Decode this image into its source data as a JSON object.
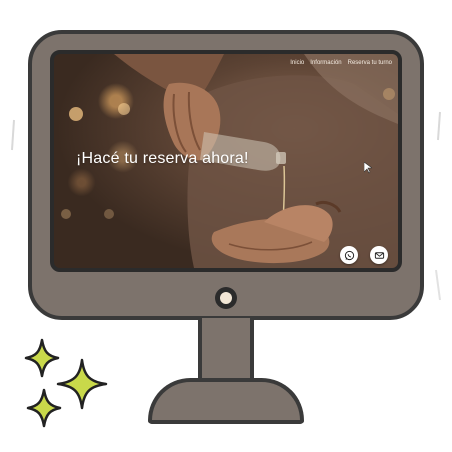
{
  "website": {
    "nav": {
      "items": [
        "Inicio",
        "Información",
        "Reserva tu turno"
      ]
    },
    "hero": {
      "title": "¡Hacé tu reserva ahora!"
    },
    "floating_buttons": [
      {
        "icon": "whatsapp-icon"
      },
      {
        "icon": "mail-icon"
      }
    ]
  },
  "colors": {
    "monitor_body": "#7d736c",
    "monitor_outline": "#3a3a3a",
    "camera_lens": "#f2e7d6",
    "sparkle_fill": "#c9d94a",
    "hero_text": "#ffffff"
  }
}
